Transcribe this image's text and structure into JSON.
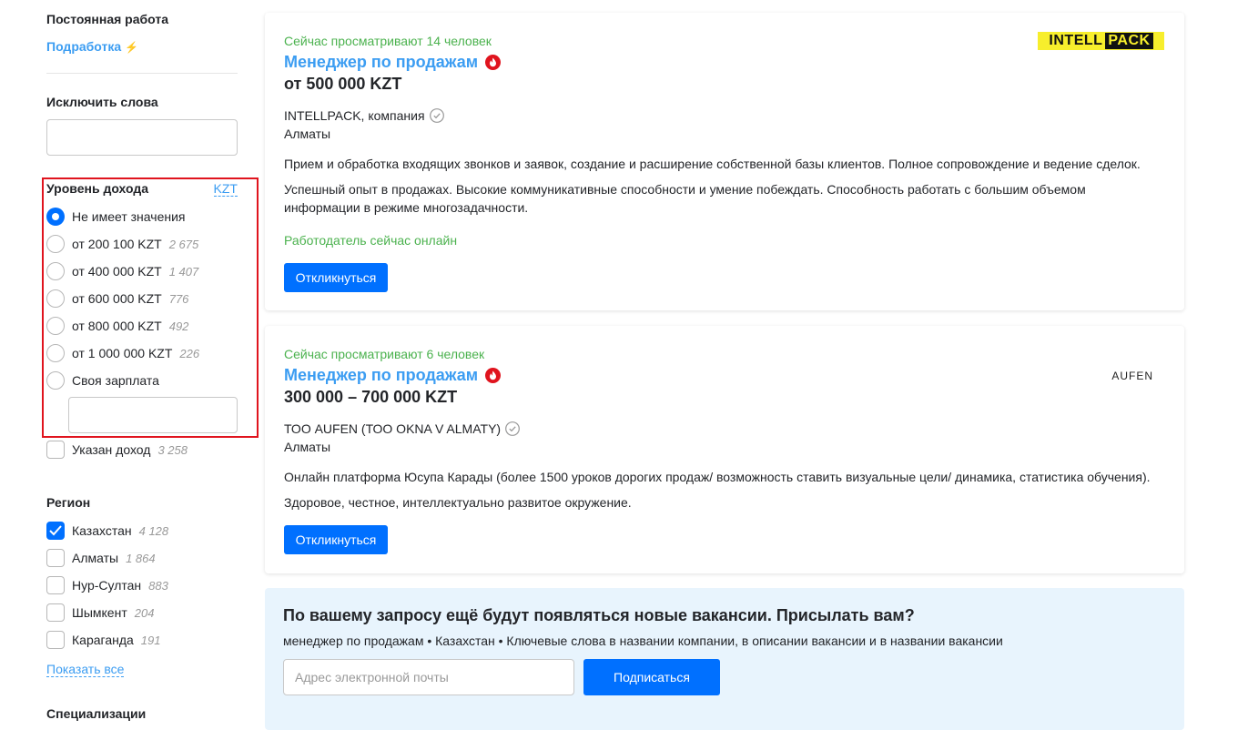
{
  "sidebar": {
    "permanent_work": "Постоянная работа",
    "part_time": "Подработка",
    "exclude_words_heading": "Исключить слова",
    "income": {
      "heading": "Уровень дохода",
      "currency_link": "KZT",
      "options": [
        {
          "label": "Не имеет значения",
          "count": "",
          "selected": true
        },
        {
          "label": "от 200 100 KZT",
          "count": "2 675",
          "selected": false
        },
        {
          "label": "от 400 000 KZT",
          "count": "1 407",
          "selected": false
        },
        {
          "label": "от 600 000 KZT",
          "count": "776",
          "selected": false
        },
        {
          "label": "от 800 000 KZT",
          "count": "492",
          "selected": false
        },
        {
          "label": "от 1 000 000 KZT",
          "count": "226",
          "selected": false
        },
        {
          "label": "Своя зарплата",
          "count": "",
          "selected": false
        }
      ],
      "income_specified": {
        "label": "Указан доход",
        "count": "3 258",
        "checked": false
      }
    },
    "region": {
      "heading": "Регион",
      "items": [
        {
          "label": "Казахстан",
          "count": "4 128",
          "checked": true
        },
        {
          "label": "Алматы",
          "count": "1 864",
          "checked": false
        },
        {
          "label": "Нур-Султан",
          "count": "883",
          "checked": false
        },
        {
          "label": "Шымкент",
          "count": "204",
          "checked": false
        },
        {
          "label": "Караганда",
          "count": "191",
          "checked": false
        }
      ],
      "show_all": "Показать все"
    },
    "specializations_heading": "Специализации"
  },
  "vacancies": [
    {
      "viewers": "Сейчас просматривают 14 человек",
      "title": "Менеджер по продажам",
      "salary": "от 500 000 KZT",
      "company": "INTELLPACK, компания",
      "city": "Алматы",
      "description": "Прием и обработка входящих звонков и заявок, создание и расширение собственной базы клиентов. Полное сопровождение и ведение сделок.",
      "requirements": "Успешный опыт в продажах. Высокие коммуникативные способности и умение побеждать. Способность работать с большим объемом информации в режиме многозадачности.",
      "employer_online": "Работодатель сейчас онлайн",
      "respond_label": "Откликнуться",
      "logo": {
        "part1": "INTELL",
        "part2": "PACK"
      }
    },
    {
      "viewers": "Сейчас просматривают 6 человек",
      "title": "Менеджер по продажам",
      "salary": "300 000 – 700 000 KZT",
      "company": "ТОО AUFEN (ТОО OKNA V ALMATY)",
      "city": "Алматы",
      "description": "Онлайн платформа Юсупа Карады (более 1500 уроков дорогих продаж/ возможность ставить визуальные цели/ динамика, статистика обучения).",
      "requirements": "Здоровое, честное, интеллектуально развитое окружение.",
      "respond_label": "Откликнуться",
      "logo": {
        "text": "AUFEN"
      }
    }
  ],
  "subscribe": {
    "title": "По вашему запросу ещё будут появляться новые вакансии. Присылать вам?",
    "query": "менеджер по продажам • Казахстан • Ключевые слова в названии компании, в описании вакансии и в названии вакансии",
    "email_placeholder": "Адрес электронной почты",
    "button": "Подписаться"
  },
  "colors": {
    "accent": "#0070ff",
    "link": "#3c9df2",
    "online": "#4bb24e",
    "highlight_box": "#e0141e"
  }
}
